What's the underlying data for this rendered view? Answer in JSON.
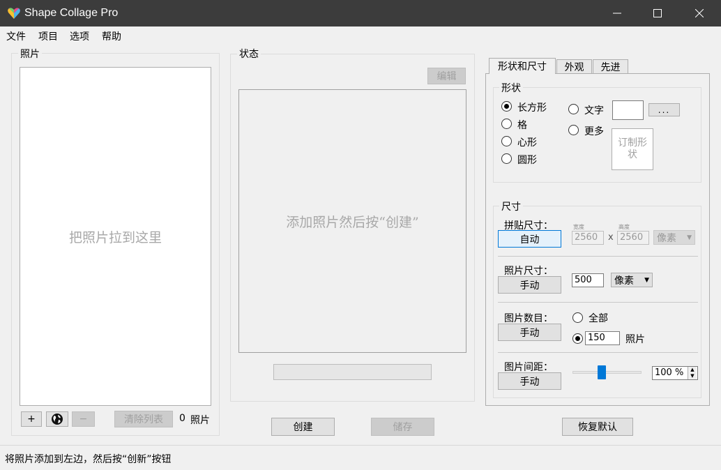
{
  "window": {
    "title": "Shape Collage Pro",
    "minimize": "—",
    "maximize": "☐",
    "close": "✕"
  },
  "menu": [
    "文件",
    "项目",
    "选项",
    "帮助"
  ],
  "photos": {
    "group_label": "照片",
    "drop_hint": "把照片拉到这里",
    "add_label": "+",
    "remove_label": "−",
    "clear_label": "清除列表",
    "count": "0",
    "count_unit": "照片"
  },
  "status": {
    "group_label": "状态",
    "edit_label": "编辑",
    "preview_hint": "添加照片然后按“创建”",
    "progress": 0
  },
  "actions": {
    "create": "创建",
    "save": "储存",
    "reset": "恢复默认"
  },
  "tabs": [
    "形状和尺寸",
    "外观",
    "先进"
  ],
  "shape": {
    "group_label": "形状",
    "options": [
      "长方形",
      "格",
      "心形",
      "圆形"
    ],
    "selected": "长方形",
    "text_label": "文字",
    "more_label": "更多",
    "browse_label": "...",
    "custom_label": "订制形状"
  },
  "size": {
    "group_label": "尺寸",
    "collage_size_label": "拼贴尺寸：",
    "collage_mode": "自动",
    "width_caption": "宽度",
    "height_caption": "高度",
    "width": "2560",
    "height": "2560",
    "x_sep": "x",
    "collage_unit": "像素",
    "photo_size_label": "照片尺寸：",
    "photo_mode": "手动",
    "photo_size": "500",
    "photo_unit": "像素",
    "photo_count_label": "图片数目：",
    "count_mode": "手动",
    "count_all_label": "全部",
    "count_value": "150",
    "count_unit": "照片",
    "spacing_label": "图片间距：",
    "spacing_mode": "手动",
    "spacing_value": "100 %",
    "spacing_slider": 0.42
  },
  "statusbar": {
    "text": "将照片添加到左边，然后按“创新”按钮"
  }
}
